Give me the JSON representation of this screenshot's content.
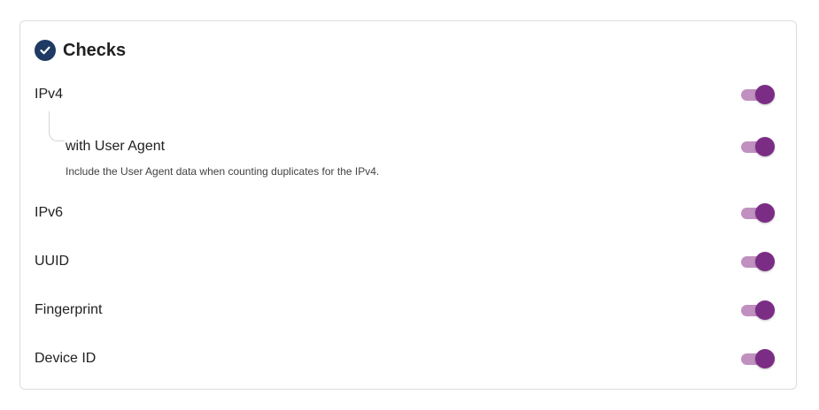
{
  "section": {
    "title": "Checks",
    "icon": "check-circle-icon"
  },
  "colors": {
    "toggle_track": "#c090c0",
    "toggle_knob": "#7b2d85",
    "header_icon": "#1f3a63"
  },
  "checks": [
    {
      "label": "IPv4",
      "enabled": true
    },
    {
      "label": "with User Agent",
      "enabled": true,
      "description": "Include the User Agent data when counting duplicates for the IPv4."
    },
    {
      "label": "IPv6",
      "enabled": true
    },
    {
      "label": "UUID",
      "enabled": true
    },
    {
      "label": "Fingerprint",
      "enabled": true
    },
    {
      "label": "Device ID",
      "enabled": true
    }
  ]
}
